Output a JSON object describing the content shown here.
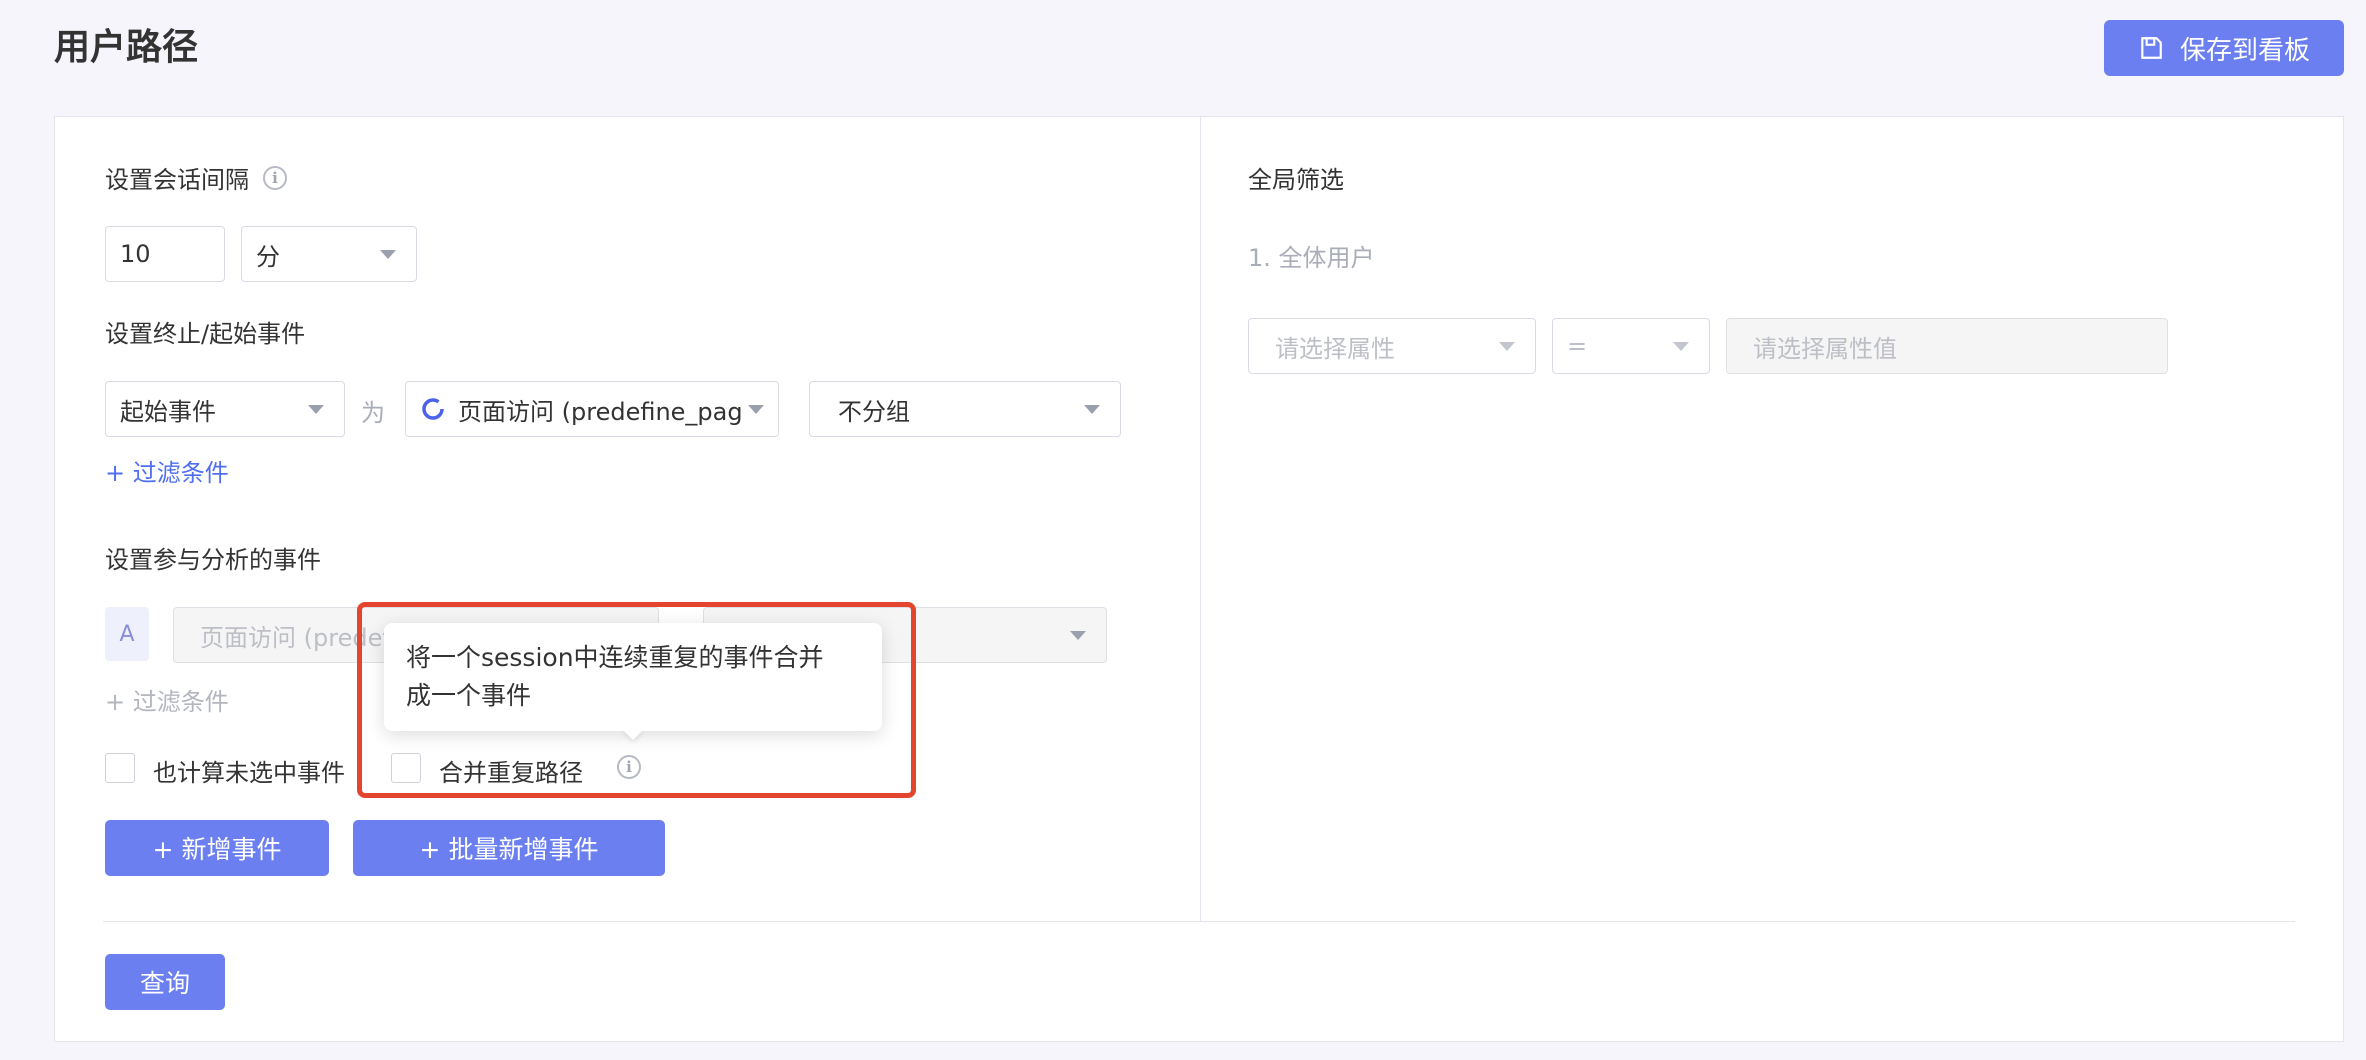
{
  "page": {
    "title": "用户路径"
  },
  "toolbar": {
    "save_label": "保存到看板"
  },
  "left": {
    "session": {
      "label": "设置会话间隔",
      "value": "10",
      "unit": "分"
    },
    "boundary": {
      "label": "设置终止/起始事件",
      "type_value": "起始事件",
      "connector": "为",
      "event_value": "页面访问 (predefine_pag",
      "group_value": "不分组",
      "filter_link": "+ 过滤条件"
    },
    "events": {
      "label": "设置参与分析的事件",
      "rows": [
        {
          "letter": "A",
          "event_value": "页面访问 (predefi"
        }
      ],
      "filter_link": "+ 过滤条件",
      "count_unselected_label": "也计算未选中事件",
      "merge_label": "合并重复路径",
      "tooltip": {
        "line1": "将一个session中连续重复的事件合并",
        "line2": "成一个事件"
      },
      "add_event_button": "+ 新增事件",
      "batch_add_button": "+ 批量新增事件"
    },
    "query_button": "查询"
  },
  "right": {
    "label": "全局筛选",
    "group_label": "1. 全体用户",
    "attribute_placeholder": "请选择属性",
    "operator_value": "=",
    "value_placeholder": "请选择属性值"
  },
  "colors": {
    "primary": "#6b7ff0",
    "link": "#4f6ef0",
    "highlight": "#e3452e",
    "background": "#f5f5fb"
  },
  "icons": [
    "save-icon",
    "info-icon",
    "caret-down-icon",
    "event-loading-icon"
  ]
}
